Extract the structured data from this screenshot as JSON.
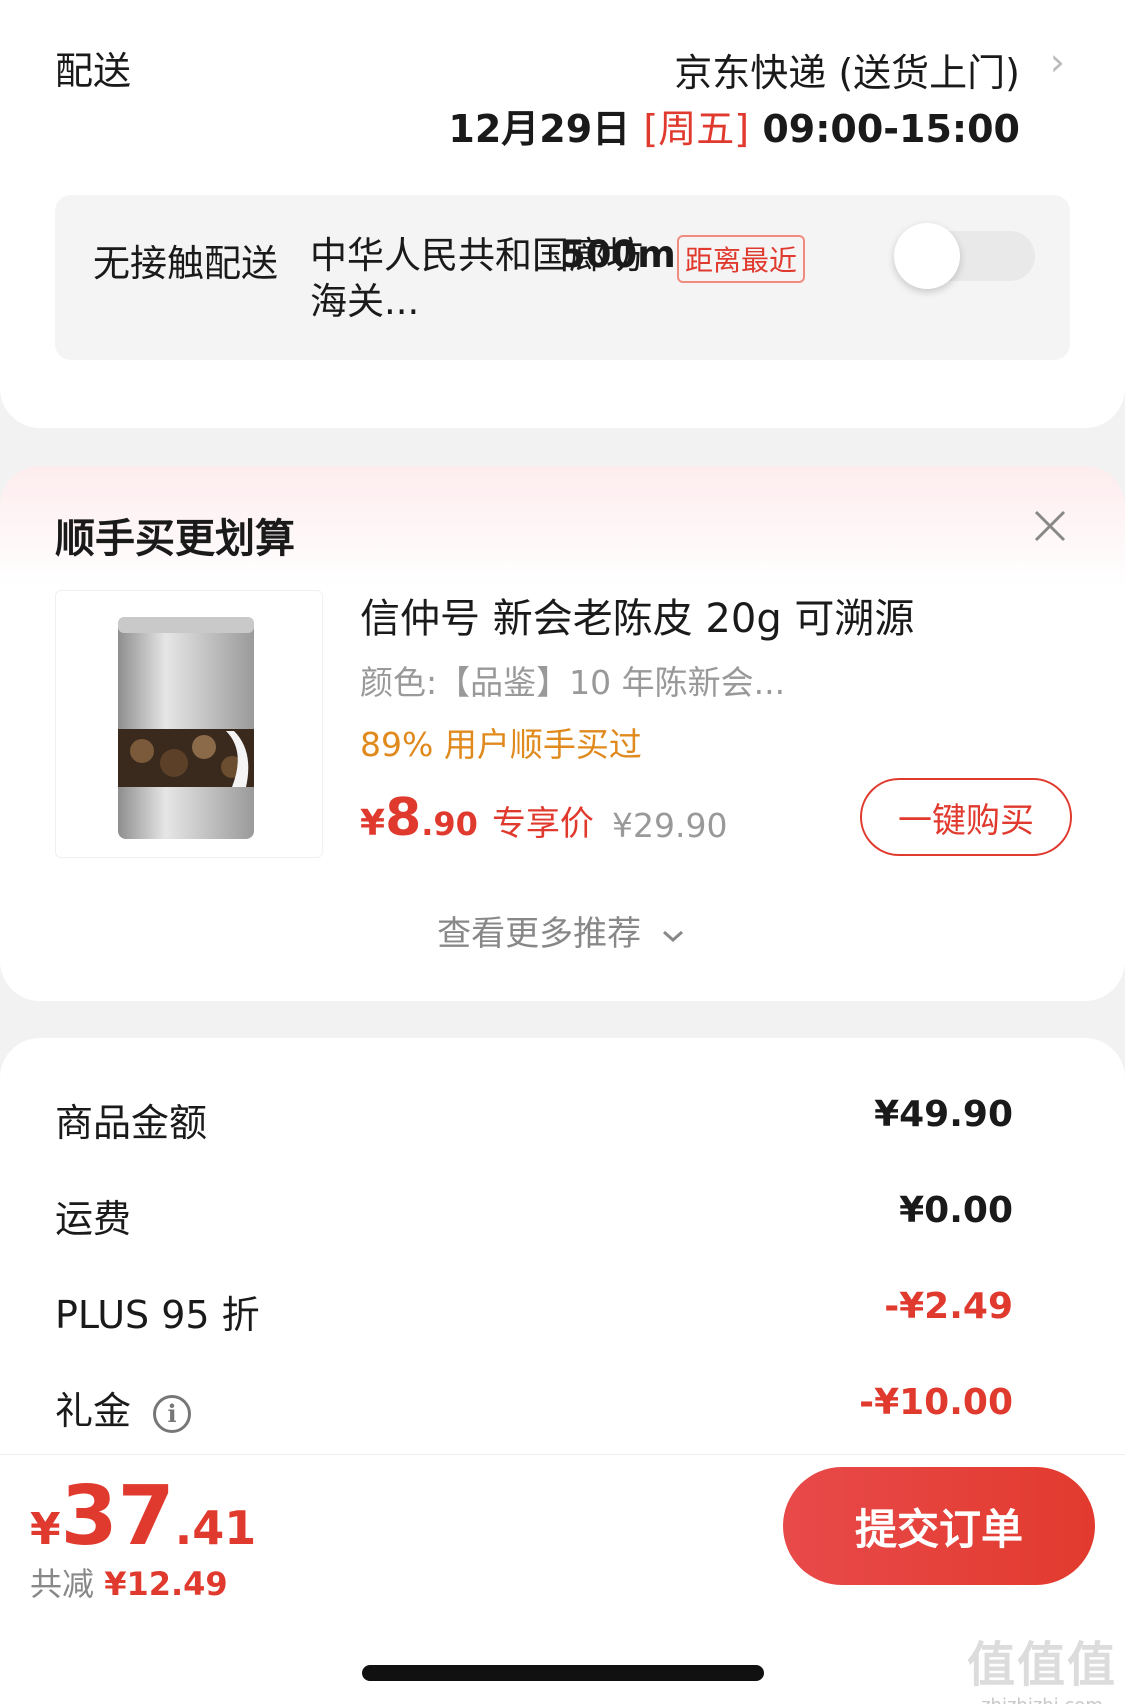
{
  "delivery": {
    "label": "配送",
    "method": "京东快递 (送货上门)",
    "chevron": "›",
    "date": "12月29日",
    "weekday": "[周五]",
    "time_range": "09:00-15:00",
    "contactless": {
      "label": "无接触配送",
      "address": "中华人民共和国廊坊海关...",
      "distance": "500m",
      "tag": "距离最近",
      "toggle_on": false
    }
  },
  "upsell": {
    "title": "顺手买更划算",
    "product": {
      "name": "信仲号 新会老陈皮 20g 可溯源",
      "spec": "颜色:【品鉴】10 年陈新会...",
      "buyers": "89% 用户顺手买过",
      "price_currency": "¥",
      "price_int": "8",
      "price_dec": ".90",
      "price_tag": "专享价",
      "original_price": "¥29.90",
      "buy_label": "一键购买"
    },
    "more_label": "查看更多推荐"
  },
  "price_detail": {
    "rows": [
      {
        "label": "商品金额",
        "value": "¥49.90"
      },
      {
        "label": "运费",
        "value": "¥0.00"
      },
      {
        "label": "PLUS 95 折",
        "value": "-¥2.49"
      },
      {
        "label": "礼金",
        "value": "-¥10.00"
      }
    ]
  },
  "footer": {
    "total_currency": "¥",
    "total_int": "37",
    "total_dec": ".41",
    "saved_label": "共减",
    "saved_amount": "¥12.49",
    "submit_label": "提交订单"
  },
  "watermark": {
    "logo": "值值值",
    "site": "zhizhizhi.com"
  },
  "colors": {
    "accent_red": "#e03a2e",
    "orange": "#e08a1e",
    "muted": "#999999"
  }
}
